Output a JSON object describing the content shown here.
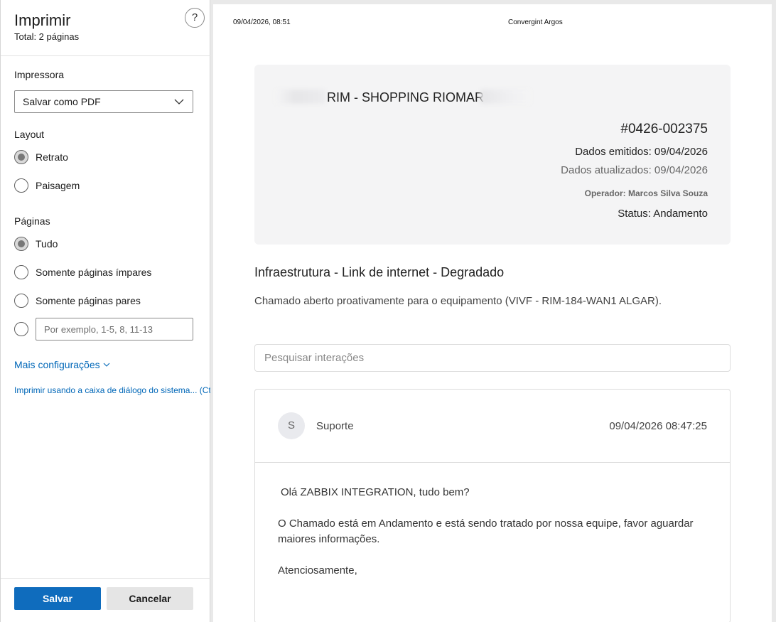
{
  "panel": {
    "title": "Imprimir",
    "subtitle": "Total: 2 páginas",
    "help_glyph": "?",
    "printer_label": "Impressora",
    "printer_value": "Salvar como PDF",
    "layout_label": "Layout",
    "layout_options": [
      "Retrato",
      "Paisagem"
    ],
    "pages_label": "Páginas",
    "pages_options": [
      "Tudo",
      "Somente páginas ímpares",
      "Somente páginas pares"
    ],
    "range_placeholder": "Por exemplo, 1-5, 8, 11-13",
    "more_settings": "Mais configurações",
    "system_dialog": "Imprimir usando a caixa de diálogo do sistema... (Ctrl+Shift+P)",
    "save": "Salvar",
    "cancel": "Cancelar"
  },
  "preview": {
    "header_date": "09/04/2026, 08:51",
    "header_site": "Convergint Argos",
    "client": "RIM - SHOPPING RIOMAR",
    "ticket_number": "#0426-002375",
    "issued": "Dados emitidos: 09/04/2026",
    "updated": "Dados atualizados: 09/04/2026",
    "operator": "Operador: Marcos Silva Souza",
    "status": "Status: Andamento",
    "title": "Infraestrutura - Link de internet - Degradado",
    "description": "Chamado aberto proativamente para o equipamento (VIVF - RIM-184-WAN1 ALGAR).",
    "search_placeholder": "Pesquisar interações",
    "interaction": {
      "avatar_letter": "S",
      "author": "Suporte",
      "timestamp": "09/04/2026 08:47:25",
      "greeting": "Olá ZABBIX INTEGRATION, tudo bem?",
      "body": "O Chamado está em Andamento e está sendo tratado por nossa equipe, favor aguardar maiores informações.",
      "closing": "Atenciosamente,"
    }
  },
  "colors": {
    "accent": "#0f6cbd",
    "link": "#0067b8",
    "card_bg": "#f4f4f5"
  }
}
